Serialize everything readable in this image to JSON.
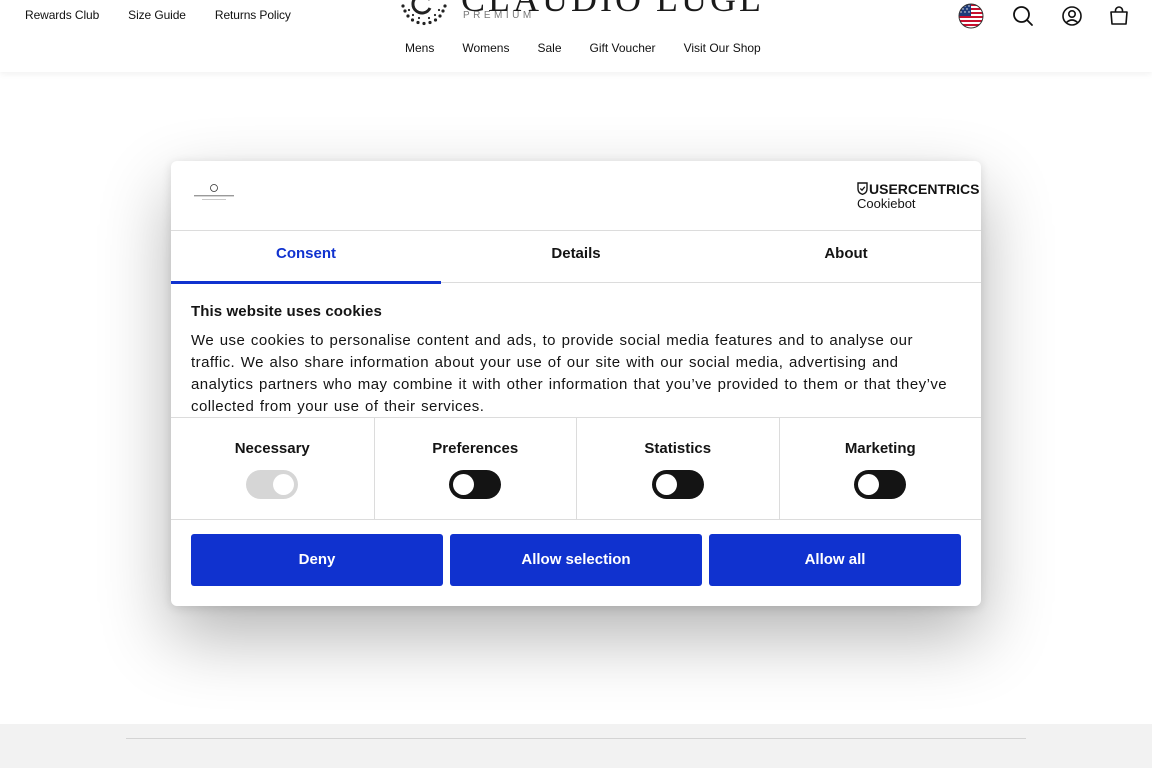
{
  "header": {
    "utility_links": [
      "Rewards Club",
      "Size Guide",
      "Returns Policy"
    ],
    "logo": {
      "name": "CLAUDIO LUGLI",
      "sub": "PREMIUM"
    },
    "nav": [
      "Mens",
      "Womens",
      "Sale",
      "Gift Voucher",
      "Visit Our Shop"
    ],
    "icons": [
      "us-flag-icon",
      "search-icon",
      "account-icon",
      "bag-icon"
    ]
  },
  "cookie_dialog": {
    "brand": {
      "top": "USERCENTRICS",
      "bottom": "Cookiebot"
    },
    "tabs": [
      {
        "label": "Consent",
        "active": true
      },
      {
        "label": "Details",
        "active": false
      },
      {
        "label": "About",
        "active": false
      }
    ],
    "heading": "This website uses cookies",
    "body": "We use cookies to personalise content and ads, to provide social media features and to analyse our traffic. We also share information about your use of our site with our social media, advertising and analytics partners who may combine it with other information that you’ve provided to them or that they’ve collected from your use of their services.",
    "toggles": [
      {
        "label": "Necessary",
        "enabled": true,
        "disabled": true
      },
      {
        "label": "Preferences",
        "enabled": false,
        "disabled": false
      },
      {
        "label": "Statistics",
        "enabled": false,
        "disabled": false
      },
      {
        "label": "Marketing",
        "enabled": false,
        "disabled": false
      }
    ],
    "buttons": {
      "deny": "Deny",
      "allow_selection": "Allow selection",
      "allow_all": "Allow all"
    }
  },
  "colors": {
    "accent": "#1032cf",
    "toggle_off": "#141414",
    "toggle_disabled": "#d6d6d6",
    "footer_bg": "#f2f2f2"
  }
}
